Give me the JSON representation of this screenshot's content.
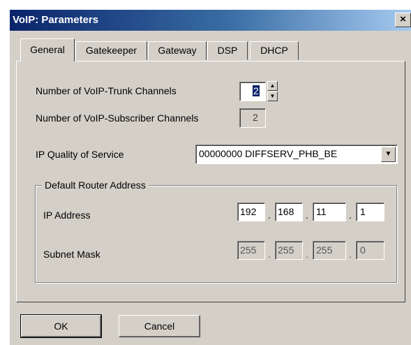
{
  "window": {
    "title": "VoIP: Parameters",
    "close_glyph": "×"
  },
  "tabs": [
    {
      "label": "General",
      "active": true
    },
    {
      "label": "Gatekeeper",
      "active": false
    },
    {
      "label": "Gateway",
      "active": false
    },
    {
      "label": "DSP",
      "active": false
    },
    {
      "label": "DHCP",
      "active": false
    }
  ],
  "general": {
    "trunk_channels_label": "Number of VoIP-Trunk Channels",
    "trunk_channels_value": "2",
    "subscriber_channels_label": "Number of VoIP-Subscriber Channels",
    "subscriber_channels_value": "2",
    "qos_label": "IP Quality of Service",
    "qos_value": "00000000  DIFFSERV_PHB_BE",
    "router_group_title": "Default Router Address",
    "ip_address_label": "IP Address",
    "ip_address": [
      "192",
      "168",
      "11",
      "1"
    ],
    "subnet_mask_label": "Subnet Mask",
    "subnet_mask": [
      "255",
      "255",
      "255",
      "0"
    ]
  },
  "footer": {
    "ok_label": "OK",
    "cancel_label": "Cancel"
  },
  "colors": {
    "dialog_bg": "#d4d0c8",
    "title_start": "#0a246a",
    "title_end": "#a6caf0"
  },
  "icons": {
    "spin_up": "▲",
    "spin_down": "▼",
    "dropdown": "▼"
  }
}
